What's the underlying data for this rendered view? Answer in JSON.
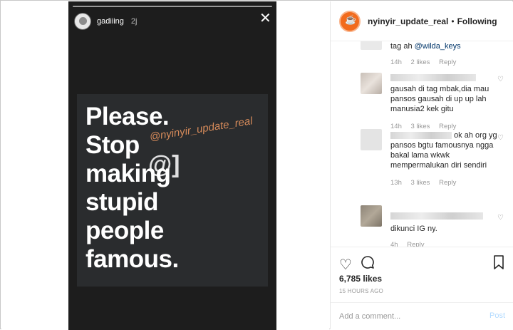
{
  "story": {
    "username": "gadiiing",
    "time": "2j",
    "close_icon": "close-icon",
    "poster_lines": [
      "Please.",
      "Stop",
      "making",
      "stupid",
      "people",
      "famous."
    ],
    "watermark": "@nyinyir_update_real",
    "watermark_mark": "@]"
  },
  "header": {
    "username": "nyinyir_update_real",
    "separator": "•",
    "follow_label": "Following",
    "avatar_color": "#f26b1d"
  },
  "comments": [
    {
      "name_visible": "",
      "text_prefix": "tag ah ",
      "mention": "@wilda_keys",
      "time": "14h",
      "likes": "2 likes",
      "reply": "Reply"
    },
    {
      "name_visible": "",
      "text_prefix": "",
      "mention": "",
      "text": "gausah di tag mbak,dia mau pansos gausah di up up lah manusia2 kek gitu",
      "time": "14h",
      "likes": "3 likes",
      "reply": "Reply"
    },
    {
      "name_visible": "ok",
      "text": "ah org yg pansos bgtu famousnya ngga bakal lama wkwk mempermalukan diri sendiri",
      "time": "13h",
      "likes": "3 likes",
      "reply": "Reply"
    },
    {
      "name_visible": "",
      "text": "dikunci IG ny.",
      "time": "4h",
      "likes": "",
      "reply": "Reply"
    }
  ],
  "actions": {
    "likes": "6,785 likes",
    "time": "15 HOURS AGO"
  },
  "add_comment": {
    "placeholder": "Add a comment...",
    "post_label": "Post"
  }
}
